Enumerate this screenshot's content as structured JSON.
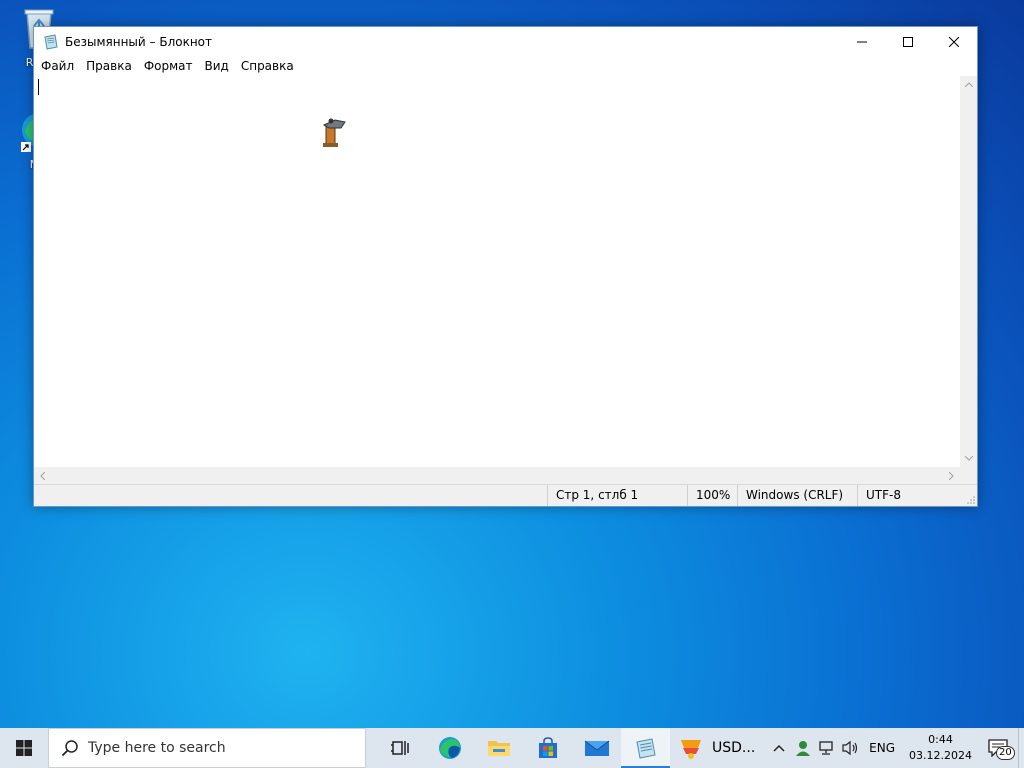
{
  "desktop": {
    "icons": [
      {
        "label_line1": "Recy",
        "icon": "recycle-bin-icon"
      },
      {
        "label_line1": "Mic",
        "label_line2": "E",
        "icon": "edge-icon"
      }
    ]
  },
  "window": {
    "title": "Безымянный – Блокнот",
    "menu": [
      "Файл",
      "Правка",
      "Формат",
      "Вид",
      "Справка"
    ],
    "content": "",
    "status": {
      "position": "Стр 1, стлб 1",
      "zoom": "100%",
      "line_ending": "Windows (CRLF)",
      "encoding": "UTF-8"
    }
  },
  "taskbar": {
    "search_placeholder": "Type here to search",
    "apps": [
      "task-view-icon",
      "edge-icon",
      "file-explorer-icon",
      "store-icon",
      "mail-icon",
      "notepad-icon"
    ],
    "usd_label": "USD...",
    "language": "ENG",
    "time": "0:44",
    "date": "03.12.2024",
    "notification_count": "20"
  }
}
